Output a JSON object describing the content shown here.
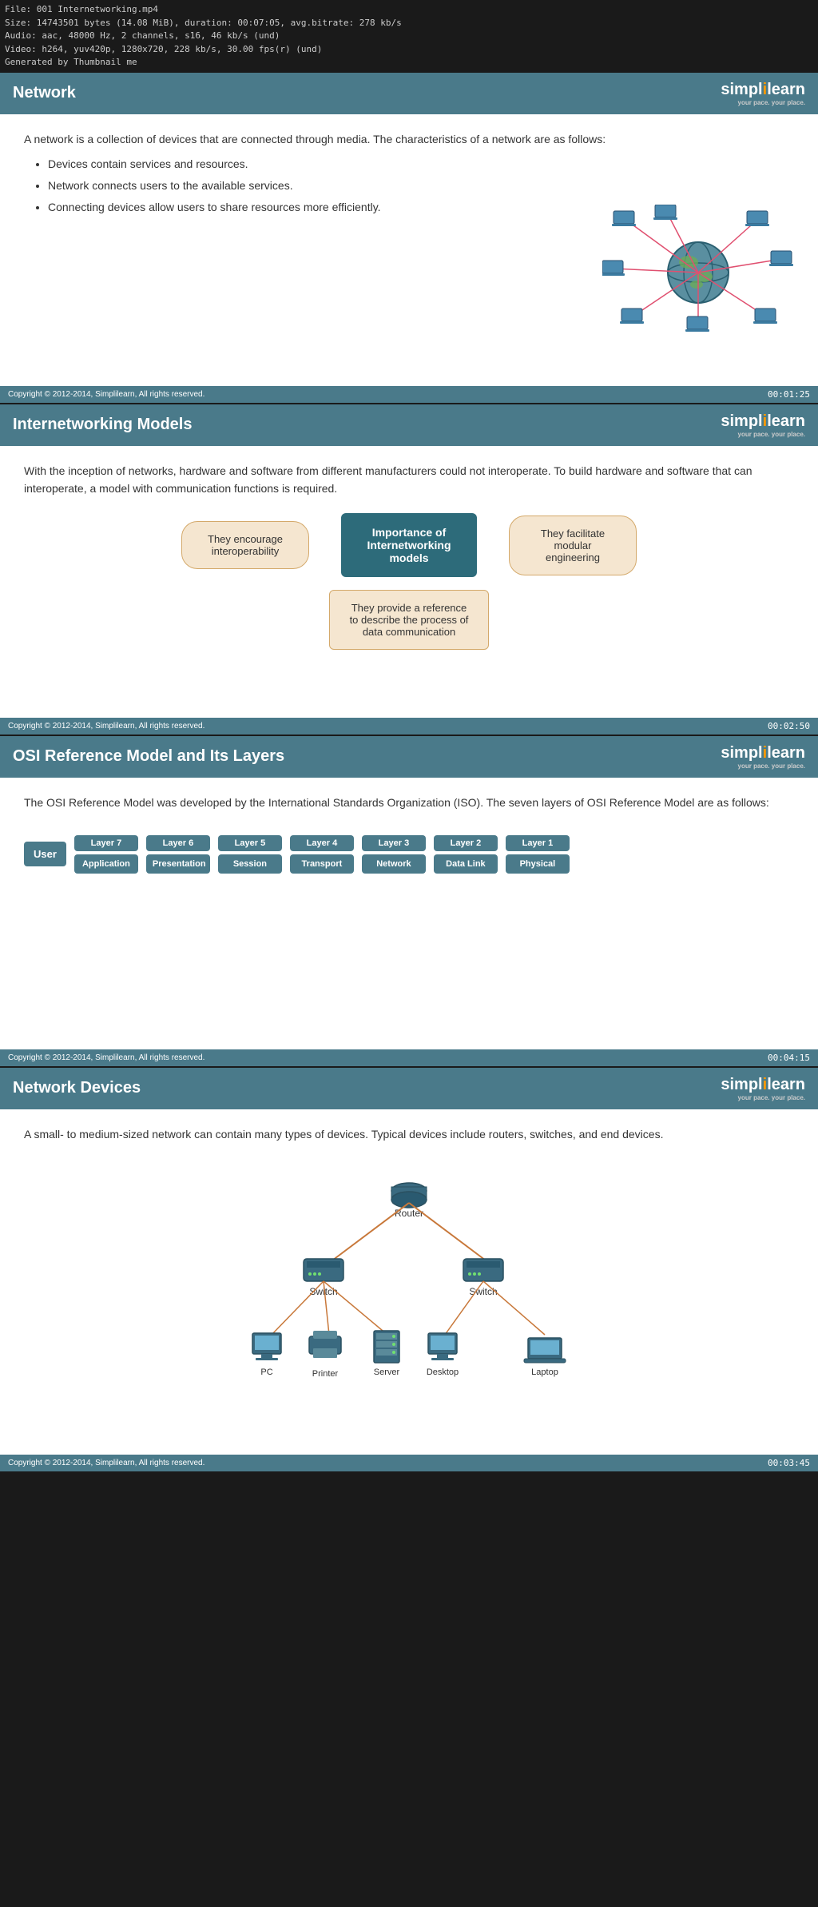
{
  "fileInfo": {
    "line1": "File: 001 Internetworking.mp4",
    "line2": "Size: 14743501 bytes (14.08 MiB), duration: 00:07:05, avg.bitrate: 278 kb/s",
    "line3": "Audio: aac, 48000 Hz, 2 channels, s16, 46 kb/s (und)",
    "line4": "Video: h264, yuv420p, 1280x720, 228 kb/s, 30.00 fps(r) (und)",
    "line5": "Generated by Thumbnail me"
  },
  "slide1": {
    "header": "Network",
    "logo": "simplilearn",
    "tagline": "your pace. your place.",
    "content": {
      "intro": "A network is a collection of devices that are connected through media. The characteristics of a network are as follows:",
      "bullets": [
        "Devices contain services and resources.",
        "Network connects users to the available services.",
        "Connecting devices allow users to share resources more efficiently."
      ]
    },
    "footer": "Copyright © 2012-2014, Simplilearn, All rights reserved.",
    "timestamp": "00:01:25"
  },
  "slide2": {
    "header": "Internetworking Models",
    "logo": "simplilearn",
    "tagline": "your pace. your place.",
    "content": {
      "intro": "With the inception of networks, hardware and software from different manufacturers could not interoperate. To build hardware and software that can interoperate, a model with communication functions is required.",
      "diagram": {
        "center": "Importance of Internetworking models",
        "box1": "They encourage interoperability",
        "box2": "They facilitate modular engineering",
        "box3": "They provide a reference to describe the process of data communication"
      }
    },
    "footer": "Copyright © 2012-2014, Simplilearn, All rights reserved.",
    "timestamp": "00:02:50"
  },
  "slide3": {
    "header": "OSI Reference Model and Its Layers",
    "logo": "simplilearn",
    "tagline": "your pace. your place.",
    "content": {
      "intro": "The OSI Reference Model was developed by the International Standards Organization (ISO). The seven layers of OSI Reference Model are as follows:",
      "layers": [
        {
          "num": "Layer 7",
          "name": "Application"
        },
        {
          "num": "Layer 6",
          "name": "Presentation"
        },
        {
          "num": "Layer 5",
          "name": "Session"
        },
        {
          "num": "Layer 4",
          "name": "Transport"
        },
        {
          "num": "Layer 3",
          "name": "Network"
        },
        {
          "num": "Layer 2",
          "name": "Data Link"
        },
        {
          "num": "Layer 1",
          "name": "Physical"
        }
      ],
      "userLabel": "User"
    },
    "footer": "Copyright © 2012-2014, Simplilearn, All rights reserved.",
    "timestamp": "00:04:15"
  },
  "slide4": {
    "header": "Network Devices",
    "logo": "simplilearn",
    "tagline": "your pace. your place.",
    "content": {
      "intro": "A small- to medium-sized network can contain many types of devices. Typical devices include routers, switches, and end devices.",
      "devices": [
        "Router",
        "Switch",
        "Switch",
        "PC",
        "Printer",
        "Server",
        "Desktop",
        "Laptop"
      ]
    },
    "footer": "Copyright © 2012-2014, Simplilearn, All rights reserved.",
    "timestamp": "00:03:45"
  }
}
